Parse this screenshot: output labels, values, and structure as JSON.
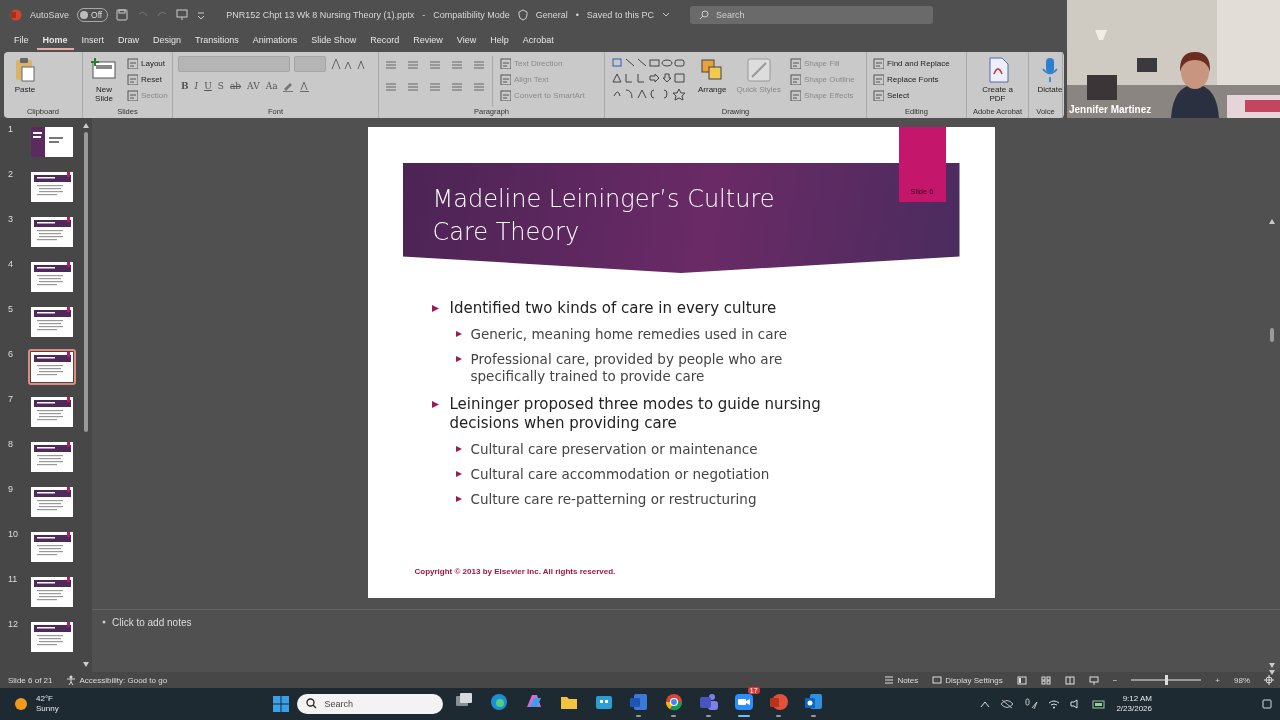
{
  "title_bar": {
    "autosave_label": "AutoSave",
    "autosave": {
      "on": false,
      "label": "Off"
    },
    "file_name": "PNR152 Chpt 13 Wk 8 Nursing Theory (1).pptx",
    "separator": "-",
    "mode": "Compatibility Mode",
    "label": "General",
    "dot": "•",
    "save_state": "Saved to this PC",
    "search": {
      "placeholder": "Search"
    }
  },
  "menu_tabs": [
    {
      "label": "File",
      "selected": false
    },
    {
      "label": "Home",
      "selected": true
    },
    {
      "label": "Insert",
      "selected": false
    },
    {
      "label": "Draw",
      "selected": false
    },
    {
      "label": "Design",
      "selected": false
    },
    {
      "label": "Transitions",
      "selected": false
    },
    {
      "label": "Animations",
      "selected": false
    },
    {
      "label": "Slide Show",
      "selected": false
    },
    {
      "label": "Record",
      "selected": false
    },
    {
      "label": "Review",
      "selected": false
    },
    {
      "label": "View",
      "selected": false
    },
    {
      "label": "Help",
      "selected": false
    },
    {
      "label": "Acrobat",
      "selected": false
    }
  ],
  "ribbon": {
    "groups": [
      {
        "kind": "clipboard",
        "label": "Clipboard",
        "items": [
          {
            "label": "Paste",
            "kind": "large",
            "disabled": false
          }
        ]
      },
      {
        "kind": "slides",
        "label": "Slides",
        "items": [
          {
            "label": "New Slide",
            "kind": "large",
            "disabled": false
          },
          {
            "label": "Layout",
            "kind": "small",
            "disabled": false
          },
          {
            "label": "Reset",
            "kind": "small",
            "disabled": false
          },
          {
            "label": "Section",
            "kind": "small",
            "disabled": true
          }
        ]
      },
      {
        "kind": "font",
        "label": "Font",
        "format_buttons": [
          "B",
          "I",
          "U",
          "S",
          "ab",
          "AV",
          "Aa"
        ]
      },
      {
        "kind": "paragraph",
        "label": "Paragraph",
        "items": [
          {
            "label": "Text Direction",
            "kind": "small",
            "disabled": true
          },
          {
            "label": "Align Text",
            "kind": "small",
            "disabled": true
          },
          {
            "label": "Convert to SmartArt",
            "kind": "small",
            "disabled": true
          }
        ]
      },
      {
        "kind": "drawing",
        "label": "Drawing",
        "items": [
          {
            "label": "Arrange",
            "kind": "large",
            "disabled": false
          },
          {
            "label": "Quick Styles",
            "kind": "large",
            "disabled": true
          },
          {
            "label": "Shape Fill",
            "kind": "small",
            "disabled": true
          },
          {
            "label": "Shape Outline",
            "kind": "small",
            "disabled": true
          },
          {
            "label": "Shape Effects",
            "kind": "small",
            "disabled": true
          }
        ]
      },
      {
        "kind": "editing",
        "label": "Editing",
        "items": [
          {
            "label": "Find and Replace",
            "kind": "small",
            "disabled": false
          },
          {
            "label": "Replace Fonts",
            "kind": "small",
            "disabled": false
          },
          {
            "label": "Select",
            "kind": "small",
            "disabled": false
          }
        ]
      },
      {
        "kind": "acrobat",
        "label": "Adobe Acrobat",
        "items": [
          {
            "label": "Create a PDF",
            "kind": "large",
            "disabled": false
          }
        ]
      },
      {
        "kind": "voice",
        "label": "Voice",
        "items": [
          {
            "label": "Dictate",
            "kind": "large",
            "disabled": false
          }
        ]
      }
    ]
  },
  "thumbnails": [
    {
      "number": "1",
      "kind": "title",
      "selected": false
    },
    {
      "number": "2",
      "kind": "content",
      "selected": false
    },
    {
      "number": "3",
      "kind": "content",
      "selected": false
    },
    {
      "number": "4",
      "kind": "content",
      "selected": false
    },
    {
      "number": "5",
      "kind": "content",
      "selected": false
    },
    {
      "number": "6",
      "kind": "content",
      "selected": true
    },
    {
      "number": "7",
      "kind": "content",
      "selected": false
    },
    {
      "number": "8",
      "kind": "content",
      "selected": false
    },
    {
      "number": "9",
      "kind": "content",
      "selected": false
    },
    {
      "number": "10",
      "kind": "content",
      "selected": false
    },
    {
      "number": "11",
      "kind": "content",
      "selected": false
    },
    {
      "number": "12",
      "kind": "content",
      "selected": false
    }
  ],
  "slide": {
    "tab": "Slide 6",
    "title": "Madeline Leininger’s Culture Care Theory",
    "bullets": [
      {
        "text": "Identified two kinds of care in every culture",
        "children": [
          {
            "text": "Generic, meaning home remedies used in care"
          },
          {
            "text": "Professional care, provided by people who are specifically trained to provide care"
          }
        ]
      },
      {
        "text": "Leininger proposed three modes to guide nursing decisions when providing care",
        "children": [
          {
            "text": "Cultural care preservation or maintenance"
          },
          {
            "text": "Cultural care accommodation or negotiation"
          },
          {
            "text": "Culture care re-patterning or restructuring"
          }
        ]
      }
    ],
    "footer": "Copyright © 2013 by Elsevier Inc. All rights reserved."
  },
  "notes": {
    "placeholder": "Click to add notes"
  },
  "status_bar": {
    "slide_count": "Slide 6 of 21",
    "accessibility": "Accessibility: Good to go",
    "notes": "Notes",
    "display_settings": "Display Settings",
    "zoom": {
      "level": 0.49,
      "minus": "−",
      "plus": "+",
      "reading": "98%"
    }
  },
  "webcam": {
    "kind": "picture",
    "name": "Jennifer Martinez"
  },
  "taskbar": {
    "weather": {
      "temperature": "42°F",
      "condition": "Sunny"
    },
    "search": {
      "placeholder": "Search"
    },
    "apps": [
      {
        "kind": "taskview",
        "running": false,
        "active": false
      },
      {
        "kind": "edge",
        "running": false,
        "active": false
      },
      {
        "kind": "copilot",
        "running": false,
        "active": false
      },
      {
        "kind": "folder",
        "running": false,
        "active": false
      },
      {
        "kind": "store",
        "running": false,
        "active": false
      },
      {
        "kind": "word",
        "running": true,
        "active": false
      },
      {
        "kind": "chrome",
        "running": true,
        "active": false
      },
      {
        "kind": "teams",
        "running": true,
        "active": false
      },
      {
        "kind": "zoom",
        "running": true,
        "active": true,
        "badge": "17"
      },
      {
        "kind": "powerpoint",
        "running": true,
        "active": false
      },
      {
        "kind": "outlook",
        "running": true,
        "active": false
      }
    ],
    "time": "9:12 AM",
    "date": "2/23/2026"
  }
}
